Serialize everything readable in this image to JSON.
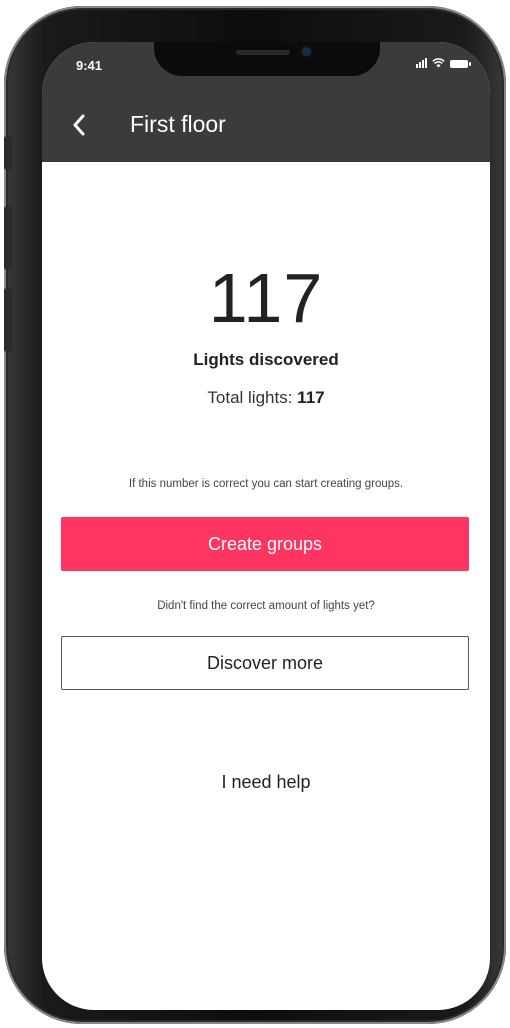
{
  "status_bar": {
    "time": "9:41",
    "icons": [
      "signal-icon",
      "wifi-icon",
      "battery-icon"
    ]
  },
  "header": {
    "back_icon": "chevron-left-icon",
    "title": "First floor"
  },
  "main": {
    "count": "117",
    "count_label": "Lights discovered",
    "total_label": "Total lights:",
    "total_value": "117",
    "hint": "If this number is correct you can start creating groups.",
    "primary_button": "Create groups",
    "question": "Didn't find the correct amount of lights yet?",
    "secondary_button": "Discover more",
    "help_link": "I need help"
  },
  "colors": {
    "header_bg": "#3b3b3b",
    "primary_button_bg": "#ff3561",
    "text": "#222222"
  }
}
